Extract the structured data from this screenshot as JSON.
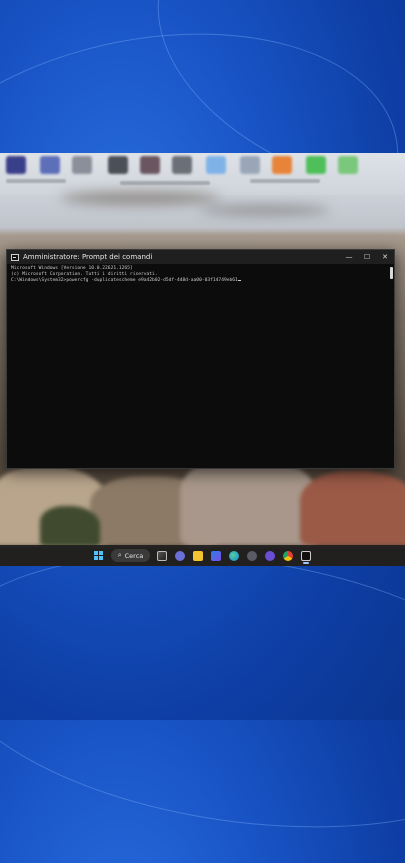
{
  "window": {
    "title": "Amministratore: Prompt dei comandi",
    "controls": {
      "minimize": "—",
      "maximize": "☐",
      "close": "✕"
    }
  },
  "console": {
    "lines": [
      "Microsoft Windows [Versione 10.0.22621.1265]",
      "(c) Microsoft Corporation. Tutti i diritti riservati.",
      "",
      "C:\\Windows\\System32>powercfg -duplicatescheme e9a42b02-d5df-448d-aa00-03f14749eb61"
    ]
  },
  "taskbar": {
    "search_label": "Cerca",
    "icons": [
      "windows-start-icon",
      "search-icon",
      "task-view-icon",
      "teams-chat-icon",
      "file-explorer-icon",
      "microsoft-store-icon",
      "edge-icon",
      "settings-icon",
      "media-player-icon",
      "chrome-icon",
      "terminal-icon"
    ]
  },
  "colors": {
    "console_bg": "#0c0c0c",
    "console_text": "#cccccc",
    "taskbar_bg": "#1e1e1e",
    "wallpaper_blue": "#1a56c8",
    "accent": "#4cc2ff"
  }
}
